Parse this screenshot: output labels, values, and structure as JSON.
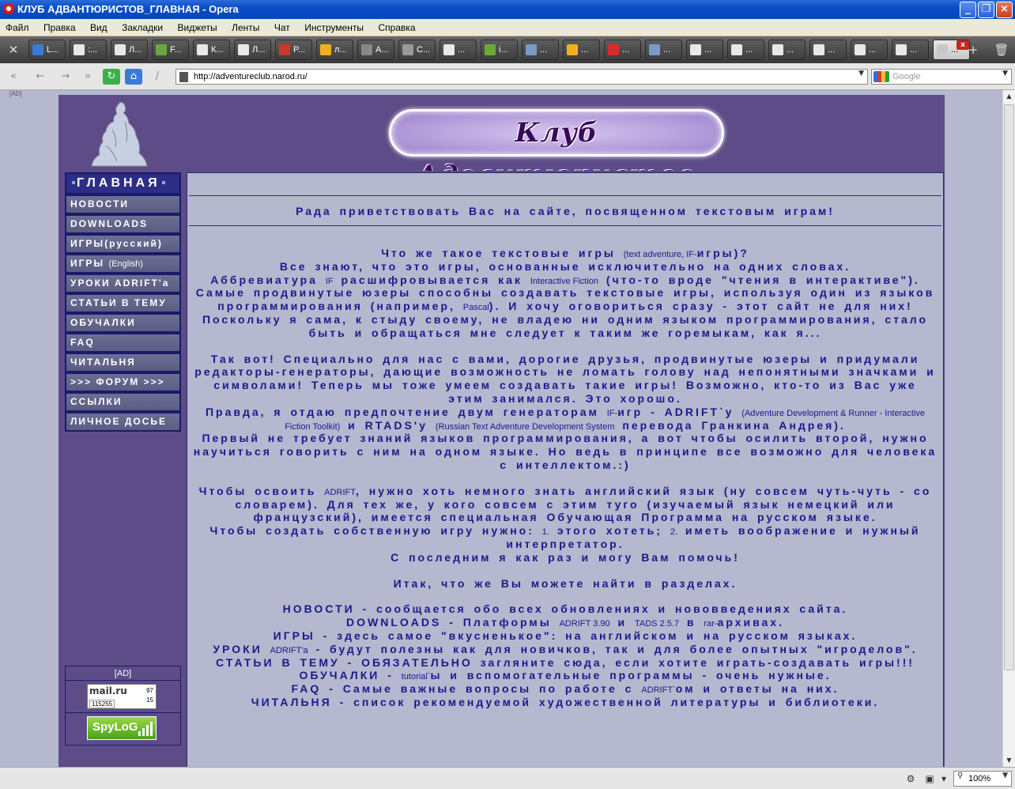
{
  "window": {
    "title": "КЛУБ АДВАНТЮРИСТОВ_ГЛАВНАЯ - Opera",
    "minimize": "_",
    "maximize": "❐",
    "close": "×"
  },
  "menu": [
    "Файл",
    "Правка",
    "Вид",
    "Закладки",
    "Виджеты",
    "Ленты",
    "Чат",
    "Инструменты",
    "Справка"
  ],
  "tabs": [
    {
      "label": "L..."
    },
    {
      "label": ":..."
    },
    {
      "label": "Л..."
    },
    {
      "label": "F..."
    },
    {
      "label": "К..."
    },
    {
      "label": "Л..."
    },
    {
      "label": "P..."
    },
    {
      "label": "л..."
    },
    {
      "label": "A..."
    },
    {
      "label": "C..."
    },
    {
      "label": "..."
    },
    {
      "label": "i..."
    },
    {
      "label": "..."
    },
    {
      "label": "..."
    },
    {
      "label": "..."
    },
    {
      "label": "..."
    },
    {
      "label": "..."
    },
    {
      "label": "..."
    },
    {
      "label": "..."
    },
    {
      "label": "..."
    },
    {
      "label": "..."
    },
    {
      "label": "..."
    },
    {
      "label": "..."
    }
  ],
  "tab_colors": [
    "#3a7ad8",
    "#e8e8e8",
    "#e8e8e8",
    "#6aaa3a",
    "#e8e8e8",
    "#e8e8e8",
    "#c83a2a",
    "#f0b020",
    "#888888",
    "#999999",
    "#e8e8e8",
    "#6aaa3a",
    "#7a9ac8",
    "#f0b020",
    "#d82a2a",
    "#7a9ac8",
    "#e8e8e8",
    "#e8e8e8",
    "#e8e8e8",
    "#e8e8e8",
    "#e8e8e8",
    "#e8e8e8",
    "#c8c8c8"
  ],
  "address": {
    "url": "http://adventureclub.narod.ru/",
    "search_placeholder": "Google"
  },
  "site": {
    "logo_text": "Клуб Адвантюристов",
    "top_strip": "[AD]"
  },
  "nav": [
    {
      "label": "ГЛАВНАЯ"
    },
    {
      "label": "НОВОСТИ"
    },
    {
      "label": "DOWNLOADS"
    },
    {
      "label": "ИГРЫ",
      "suffix": "(русский)"
    },
    {
      "label": "ИГРЫ",
      "suffix": "(English)"
    },
    {
      "label": "УРОКИ ADRIFT'a"
    },
    {
      "label": "СТАТЬИ В ТЕМУ"
    },
    {
      "label": "ОБУЧАЛКИ"
    },
    {
      "label": "FAQ"
    },
    {
      "label": "ЧИТАЛЬНЯ"
    },
    {
      "label": ">>> ФОРУМ >>>"
    },
    {
      "label": "ССЫЛКИ"
    },
    {
      "label": "ЛИЧНОЕ ДОСЬЕ"
    }
  ],
  "badges": {
    "ad": "[AD]",
    "mailru": {
      "logo": "mail.ru",
      "n1": "97",
      "n2": "15",
      "n3": "115255"
    },
    "spylog": "SpyLoG"
  },
  "content": {
    "welcome": "Рада приветствовать Вас на сайте, посвященном текстовым играм!",
    "p1": [
      [
        "Что же такое текстовые игры ",
        "(text adventure, IF-",
        "игры)?"
      ],
      [
        "Все знают, что это игры, основанные исключительно на одних словах."
      ],
      [
        "Аббревиатура ",
        "IF",
        " расшифровывается как ",
        "Interactive Fiction",
        " (что-то вроде \"чтения в интерактиве\")."
      ],
      [
        "Самые продвинутые юзеры способны создавать текстовые игры, используя один из языков программирования (например, ",
        "Pascal",
        "). И хочу оговориться сразу - этот сайт не для них!"
      ],
      [
        "Поскольку я сама, к стыду своему, не владею ни одним языком программирования, стало быть и обращаться мне следует к таким же горемыкам, как я..."
      ]
    ],
    "p2": [
      "Так вот! Специально для нас с вами, дорогие друзья, продвинутые юзеры и придумали редакторы-генераторы, дающие возможность не ломать голову над непонятными значками и символами! Теперь мы тоже умеем создавать такие игры! Возможно, кто-то из Вас уже этим занимался. Это хорошо.",
      "Правда, я отдаю предпочтение двум генераторам ",
      "IF-",
      "игр - ADRIFT`у ",
      "(Adventure Development & Runner - Interactive Fiction Toolkit)",
      " и RTADS'у ",
      "(Russian Text Adventure Development System",
      " перевода Гранкина Андрея).",
      "Первый не требует знаний языков программирования, а вот чтобы осилить второй, нужно научиться говорить с ним на одном языке. Но ведь в принципе все возможно для человека с интеллектом.:)"
    ],
    "p3": [
      "Чтобы освоить ",
      "ADRIFT",
      ", нужно хоть немного знать английский язык (ну совсем чуть-чуть - со словарем). Для тех же, у кого совсем с этим туго (изучаемый язык немецкий или французский), имеется специальная Обучающая Программа на русском языке.",
      "Чтобы создать собственную игру нужно: ",
      "1.",
      " этого хотеть; ",
      "2.",
      " иметь воображение и нужный интерпретатор.",
      "С последним я как раз и могу Вам помочь!"
    ],
    "p4": "Итак, что же Вы можете найти в разделах.",
    "p5": {
      "news": "НОВОСТИ - сообщается обо всех обновлениях и нововведениях сайта.",
      "dl_a": "DOWNLOADS - ",
      "dl_b": "Платформы ",
      "dl_c": "ADRIFT 3.90",
      "dl_d": " и ",
      "dl_e": "TADS 2.5.7",
      "dl_f": " в ",
      "dl_g": "rar-",
      "dl_h": "архивах.",
      "games": "ИГРЫ - здесь самое \"вкусненькое\": на английском и на русском языках.",
      "lessons_a": "УРОКИ ",
      "lessons_b": "ADRIFT'a",
      "lessons_c": " - будут полезны как для новичков, так и для более опытных \"игроделов\".",
      "articles": "СТАТЬИ В ТЕМУ - ОБЯЗАТЕЛЬНО загляните сюда, если хотите играть-создавать игры!!!",
      "tutor_a": "ОБУЧАЛКИ - ",
      "tutor_b": "tutorial`",
      "tutor_c": "ы и вспомогательные программы - очень нужные.",
      "faq_a": "FAQ",
      "faq_b": " - Самые важные вопросы по работе с ",
      "faq_c": "ADRIFT`",
      "faq_d": "ом и ответы на них.",
      "read": "ЧИТАЛЬНЯ - список рекомендуемой художественной литературы и библиотеки."
    }
  },
  "status": {
    "zoom": "100%"
  }
}
